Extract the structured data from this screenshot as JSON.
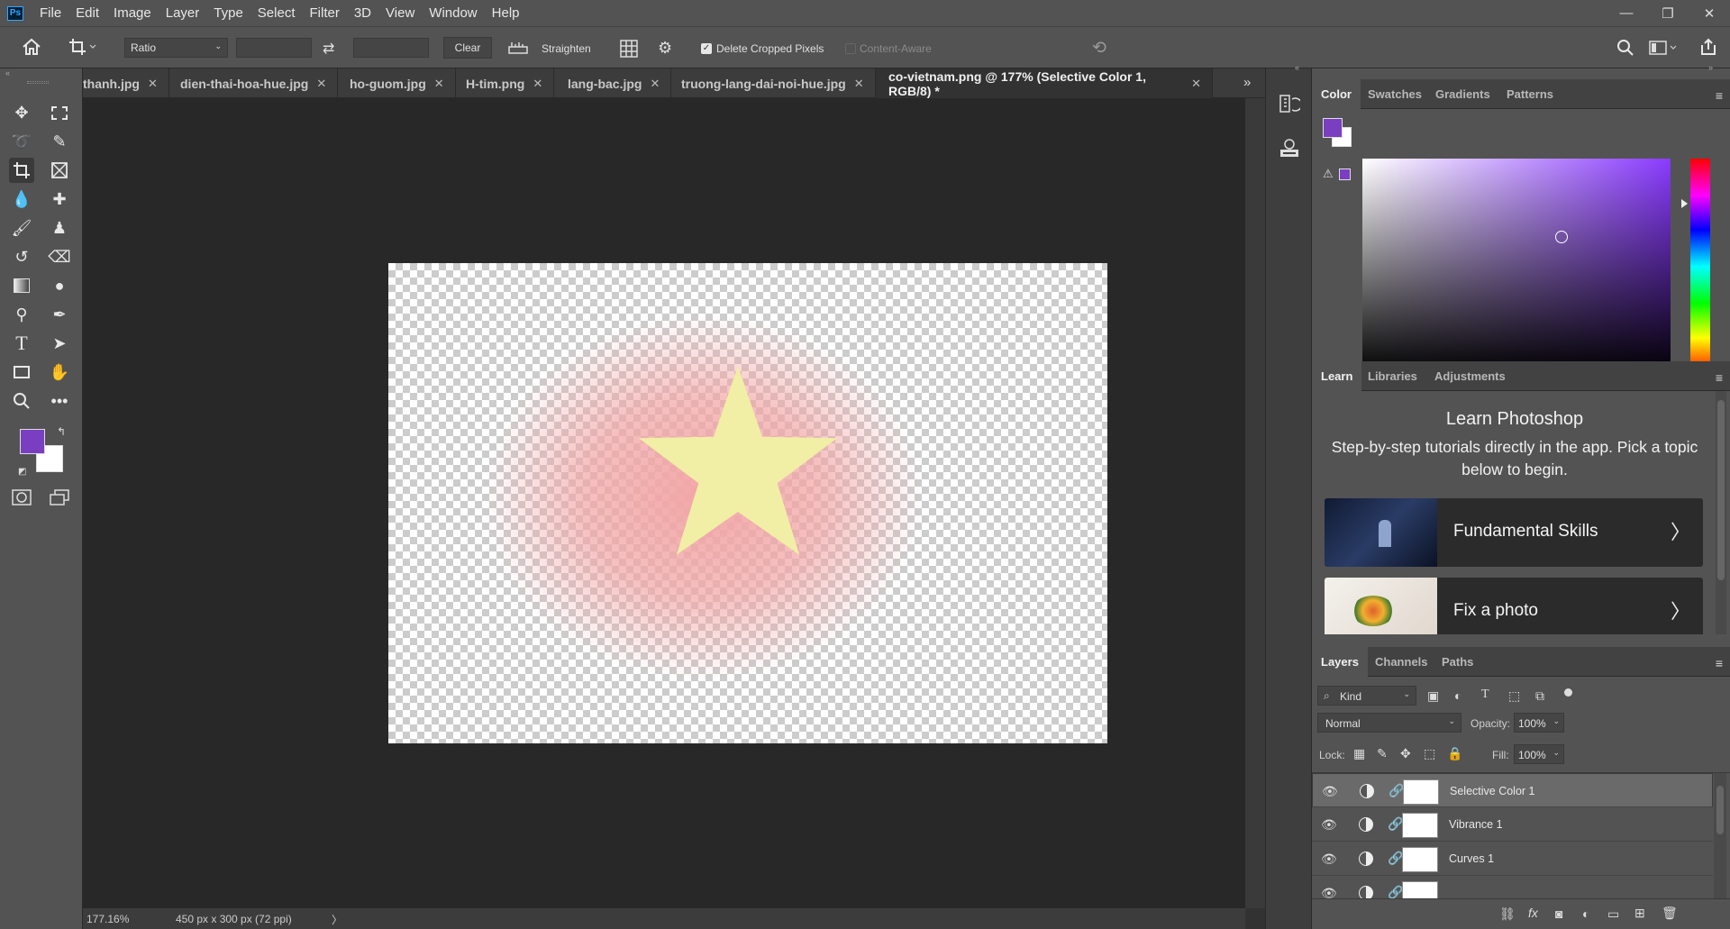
{
  "menubar": {
    "logo": "Ps",
    "items": [
      "File",
      "Edit",
      "Image",
      "Layer",
      "Type",
      "Select",
      "Filter",
      "3D",
      "View",
      "Window",
      "Help"
    ]
  },
  "window_controls": {
    "minimize": "—",
    "restore": "❐",
    "close": "✕"
  },
  "options": {
    "ratio": "Ratio",
    "clear": "Clear",
    "straighten": "Straighten",
    "delete_cropped": "Delete Cropped Pixels",
    "delete_cropped_checked": true,
    "content_aware": "Content-Aware"
  },
  "tabs": [
    {
      "label": "thanh.jpg"
    },
    {
      "label": "dien-thai-hoa-hue.jpg"
    },
    {
      "label": "ho-guom.jpg"
    },
    {
      "label": "H-tim.png"
    },
    {
      "label": "lang-bac.jpg"
    },
    {
      "label": "truong-lang-dai-noi-hue.jpg"
    },
    {
      "label": "co-vietnam.png @ 177% (Selective Color 1, RGB/8) *",
      "active": true
    }
  ],
  "status": {
    "zoom": "177.16%",
    "doc_info": "450 px x 300 px (72 ppi)",
    "arrow": "〉"
  },
  "colors": {
    "foreground": "#7a3fc0",
    "background": "#ffffff",
    "star": "#f1eea5",
    "flag_red": "#f2a6a6"
  },
  "color_panel": {
    "tabs": [
      "Color",
      "Swatches",
      "Gradients",
      "Patterns"
    ]
  },
  "learn_panel": {
    "tabs": [
      "Learn",
      "Libraries",
      "Adjustments"
    ],
    "title": "Learn Photoshop",
    "description": "Step-by-step tutorials directly in the app. Pick a topic below to begin.",
    "cards": [
      {
        "title": "Fundamental Skills"
      },
      {
        "title": "Fix a photo"
      }
    ]
  },
  "layers_panel": {
    "tabs": [
      "Layers",
      "Channels",
      "Paths"
    ],
    "filter_kind": "Kind",
    "blend_mode": "Normal",
    "opacity_label": "Opacity:",
    "opacity": "100%",
    "lock_label": "Lock:",
    "fill_label": "Fill:",
    "fill": "100%",
    "layers": [
      {
        "name": "Selective Color 1",
        "selected": true
      },
      {
        "name": "Vibrance 1"
      },
      {
        "name": "Curves 1"
      }
    ]
  }
}
